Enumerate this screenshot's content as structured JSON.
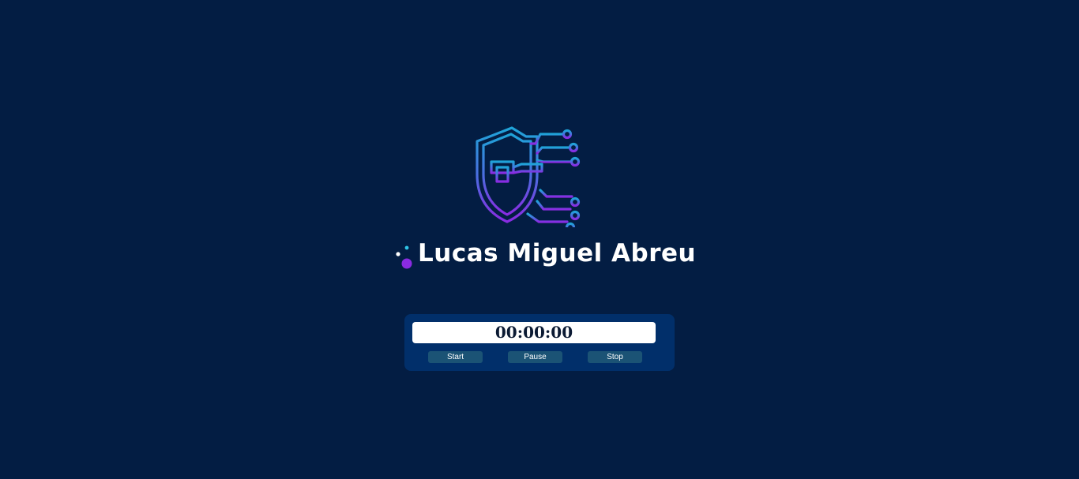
{
  "brand": {
    "logo_icon": "shield-circuit-icon",
    "name": "Lucas Miguel Abreu",
    "colors": {
      "gradient_top": "#1fa4d8",
      "gradient_mid": "#4a6fe0",
      "gradient_bottom": "#8a2be2",
      "dot_cyan": "#2fc4e6",
      "dot_purple": "#8a2be2"
    }
  },
  "stopwatch": {
    "time": "00:00:00",
    "buttons": {
      "start": "Start",
      "pause": "Pause",
      "stop": "Stop"
    }
  },
  "colors": {
    "background": "#031d43",
    "panel": "#012f6a",
    "button": "#1b5375"
  }
}
